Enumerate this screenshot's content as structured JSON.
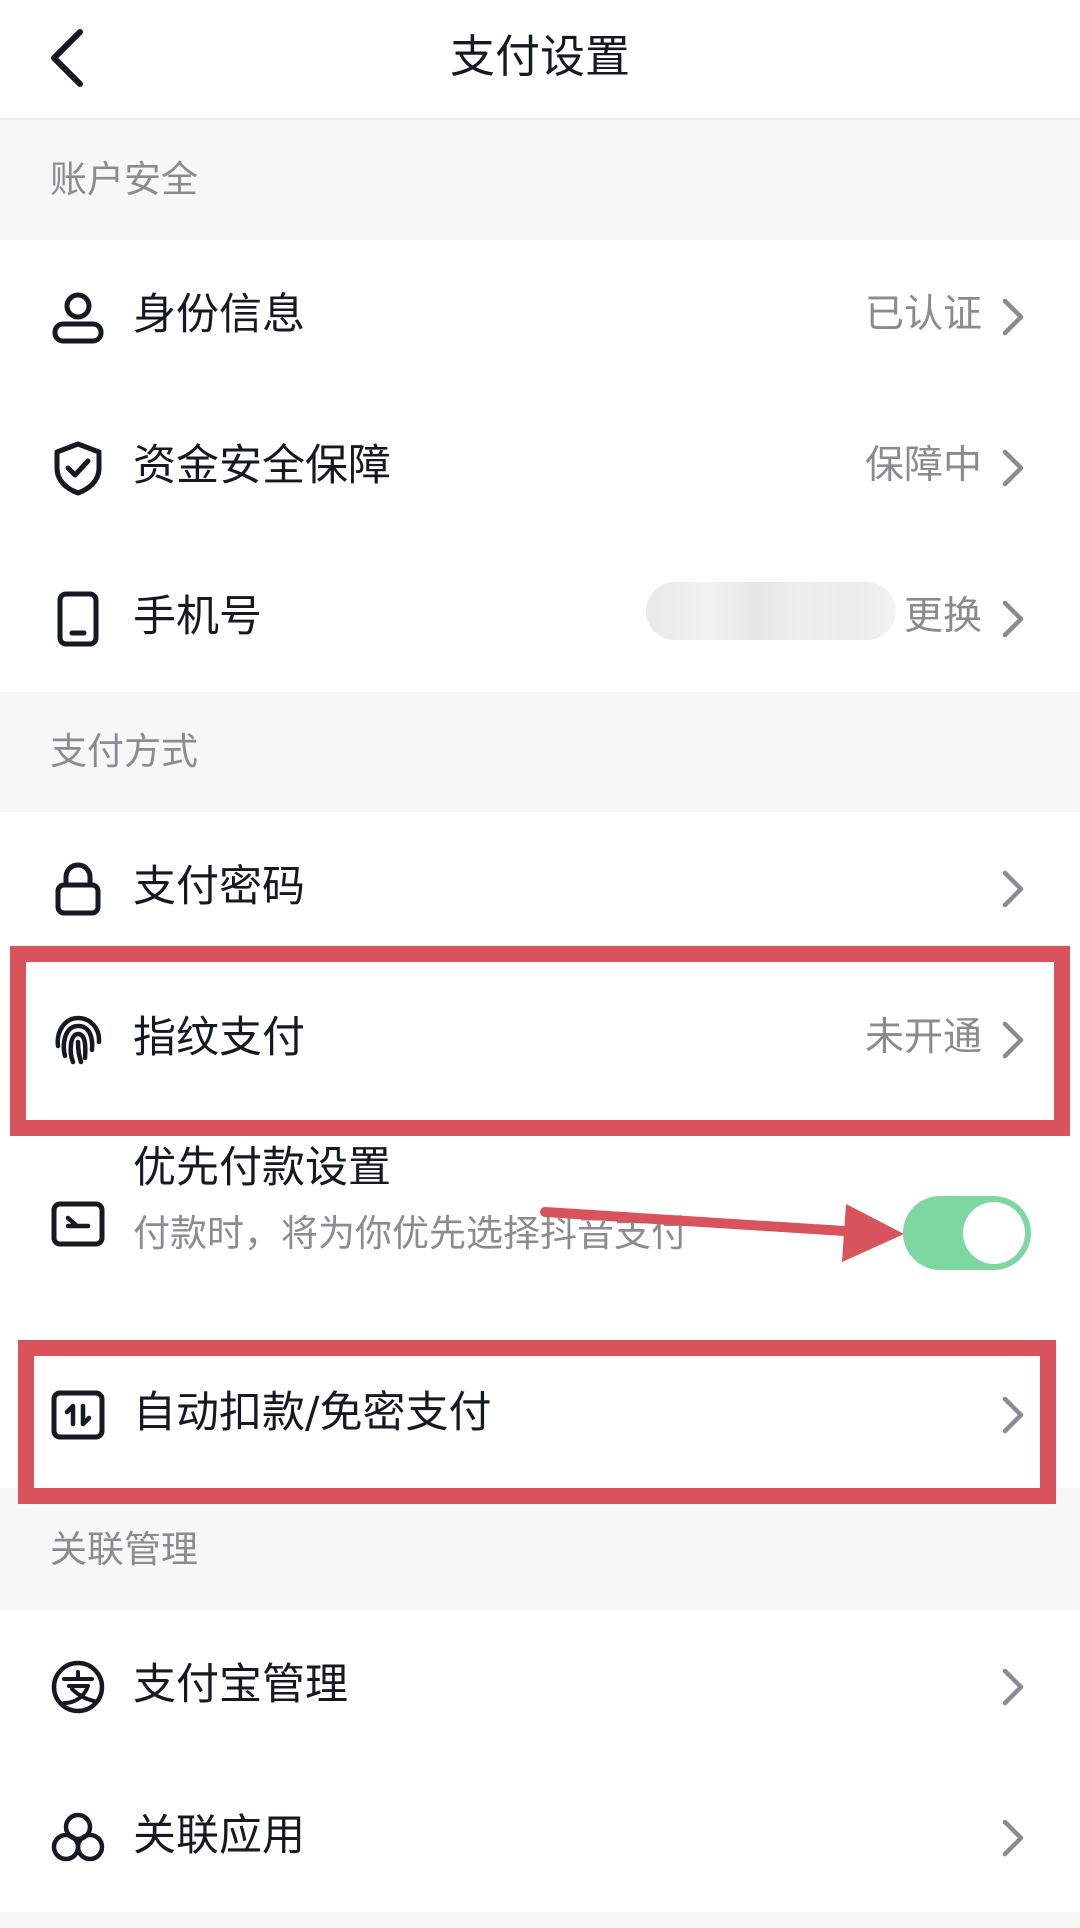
{
  "header": {
    "title": "支付设置",
    "back_icon": "chevron-left-icon"
  },
  "sections": {
    "account_security": {
      "title": "账户安全",
      "items": [
        {
          "label": "身份信息",
          "value": "已认证",
          "icon": "person-icon"
        },
        {
          "label": "资金安全保障",
          "value": "保障中",
          "icon": "shield-check-icon"
        },
        {
          "label": "手机号",
          "value": "更换",
          "icon": "phone-icon"
        }
      ]
    },
    "payment_methods": {
      "title": "支付方式",
      "items": [
        {
          "label": "支付密码",
          "value": "",
          "icon": "lock-icon"
        },
        {
          "label": "指纹支付",
          "value": "未开通",
          "icon": "fingerprint-icon"
        }
      ],
      "priority": {
        "label": "优先付款设置",
        "subtitle": "付款时，将为你优先选择抖音支付",
        "enabled": true,
        "icon": "card-icon"
      },
      "auto_deduct": {
        "label": "自动扣款/免密支付",
        "icon": "auto-pay-icon"
      }
    },
    "linked": {
      "title": "关联管理",
      "items": [
        {
          "label": "支付宝管理",
          "icon": "alipay-icon"
        },
        {
          "label": "关联应用",
          "icon": "apps-icon"
        }
      ]
    }
  },
  "colors": {
    "toggle_on": "#7ed7a0",
    "annotation": "#d9535c",
    "secondary_text": "#8b8c92"
  }
}
